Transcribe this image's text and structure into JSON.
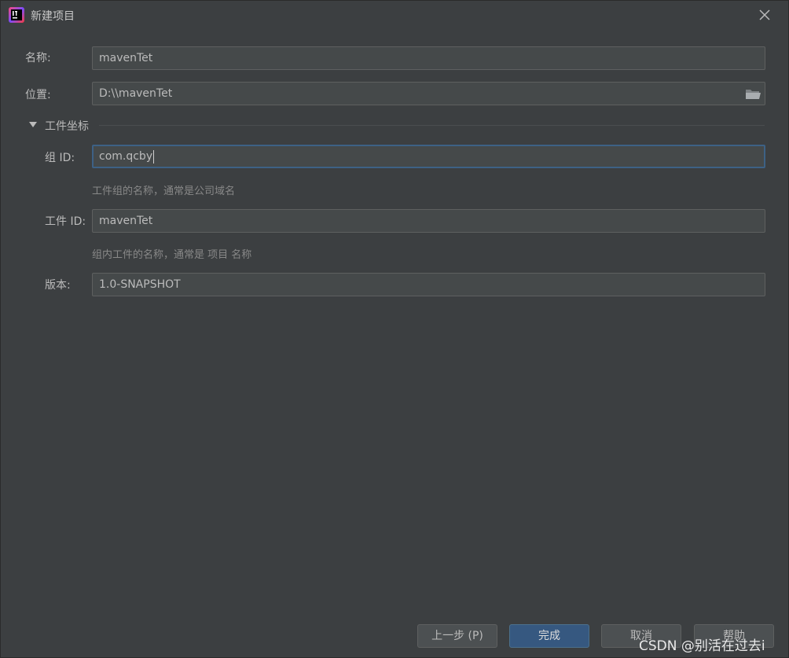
{
  "window": {
    "title": "新建项目"
  },
  "form": {
    "name_label": "名称:",
    "name_value": "mavenTet",
    "location_label": "位置:",
    "location_value": "D:\\\\mavenTet",
    "section_label": "工件坐标",
    "group_label": "组 ID:",
    "group_value": "com.qcby",
    "group_hint": "工件组的名称，通常是公司域名",
    "artifact_label": "工件 ID:",
    "artifact_value": "mavenTet",
    "artifact_hint": "组内工件的名称，通常是 项目 名称",
    "version_label": "版本:",
    "version_value": "1.0-SNAPSHOT"
  },
  "buttons": {
    "prev": "上一步 (P)",
    "finish": "完成",
    "cancel": "取消",
    "help": "帮助"
  },
  "watermark": "CSDN @别活在过去i",
  "colors": {
    "background": "#3c3f41",
    "field": "#45494a",
    "focus": "#3d6185",
    "primary_button": "#365880"
  }
}
